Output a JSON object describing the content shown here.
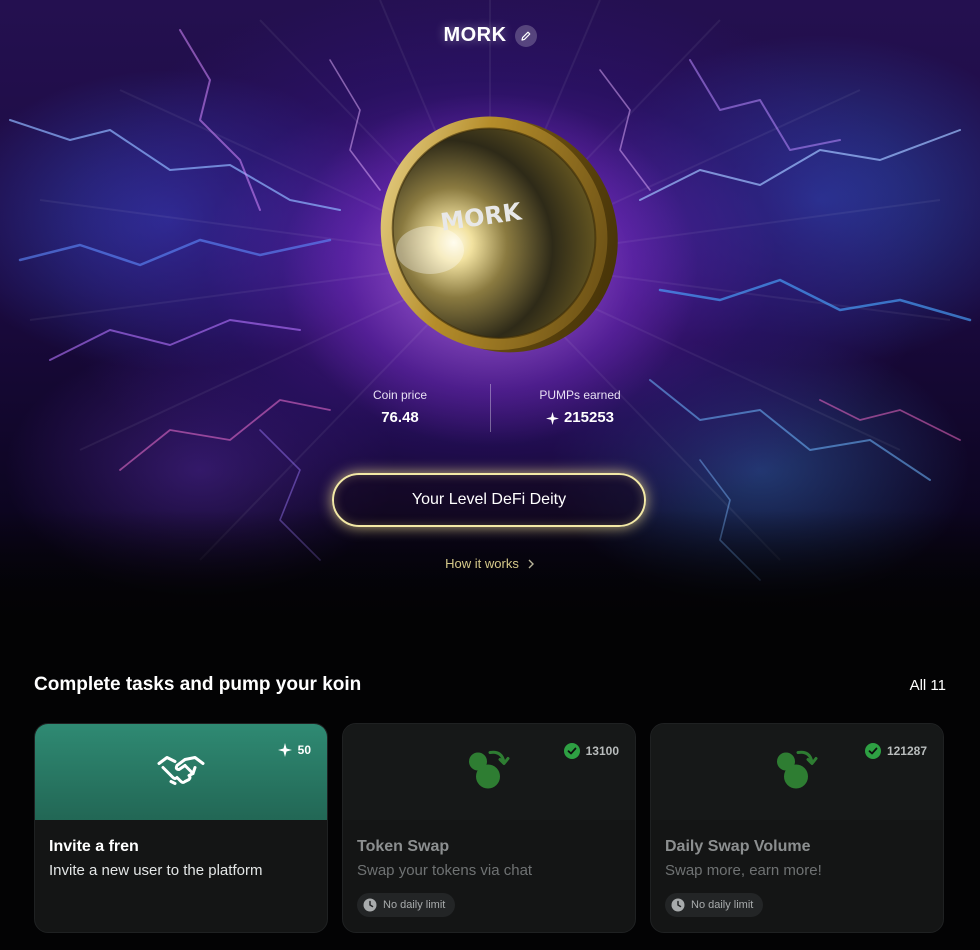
{
  "app": {
    "title": "MORK",
    "coin_engraving": "MORK"
  },
  "stats": {
    "coin_price_label": "Coin price",
    "coin_price_value": "76.48",
    "pumps_label": "PUMPs earned",
    "pumps_value": "215253"
  },
  "level_button": {
    "label": "Your Level DeFi Deity"
  },
  "how_it_works": {
    "label": "How it works"
  },
  "tasks": {
    "title": "Complete tasks and pump your koin",
    "all_label": "All 11",
    "cards": [
      {
        "title": "Invite a fren",
        "description": "Invite a new user to the platform",
        "badge": "50",
        "icon": "handshake-icon",
        "state": "active"
      },
      {
        "title": "Token Swap",
        "description": "Swap your tokens via chat",
        "badge": "13100",
        "icon": "swap-coins-icon",
        "state": "completed",
        "limit": "No daily limit"
      },
      {
        "title": "Daily Swap Volume",
        "description": "Swap more, earn more!",
        "badge": "121287",
        "icon": "swap-coins-icon",
        "state": "completed",
        "limit": "No daily limit"
      }
    ]
  },
  "colors": {
    "accent_green": "#2f8a73",
    "check_green": "#2ea043",
    "glow_yellow": "#f3e9a6",
    "link_gold": "#d5c98a",
    "hero_purple": "#7a2fd6"
  }
}
